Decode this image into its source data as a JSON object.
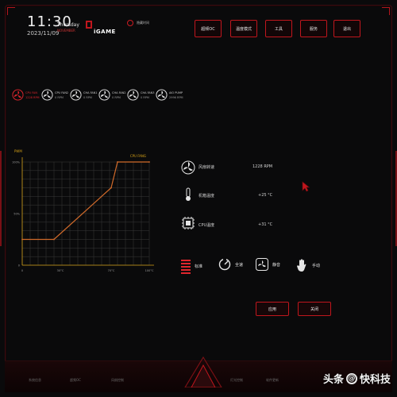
{
  "header": {
    "time": "11:30",
    "date": "2023/11/09",
    "weekday": "Thursday",
    "weekday_sub": "NOVEMBER",
    "logo_text": "iGAME",
    "toggle_label": "隐藏时间"
  },
  "nav": {
    "items": [
      {
        "label": "超频OC",
        "left": 245
      },
      {
        "label": "温度模式",
        "left": 290
      },
      {
        "label": "工具",
        "left": 334
      },
      {
        "label": "服务",
        "left": 378
      },
      {
        "label": "退出",
        "left": 420
      }
    ]
  },
  "fans": [
    {
      "name": "CPU FAN",
      "rpm": "1228 RPM",
      "active": true
    },
    {
      "name": "CPU FAN2",
      "rpm": "0 RPM",
      "active": false
    },
    {
      "name": "CHA FAN1",
      "rpm": "0 RPM",
      "active": false
    },
    {
      "name": "CHA FAN2",
      "rpm": "0 RPM",
      "active": false
    },
    {
      "name": "CHA FAN3",
      "rpm": "0 RPM",
      "active": false
    },
    {
      "name": "AIO PUMP",
      "rpm": "2996 RPM",
      "active": false
    }
  ],
  "chart_data": {
    "type": "line",
    "title": "PWM",
    "series": [
      {
        "name": "CPU FANG",
        "x": [
          0,
          25,
          70,
          75,
          100
        ],
        "y": [
          25,
          25,
          75,
          100,
          100
        ]
      }
    ],
    "xlabel": "",
    "ylabel": "PWM",
    "x_ticks": [
      "0",
      "30°C",
      "70°C",
      "100°C"
    ],
    "y_ticks": [
      "0",
      "50%",
      "100%"
    ],
    "xlim": [
      0,
      100
    ],
    "ylim": [
      0,
      100
    ],
    "grid": true,
    "colors": {
      "line": "#d06a2a",
      "grid": "#3a3a3a",
      "axis": "#d4a017"
    }
  },
  "info": {
    "fan_speed_label": "风扇转速",
    "fan_speed_value": "1228 RPM",
    "case_temp_label": "机箱温度",
    "case_temp_value": "+25 °C",
    "cpu_temp_label": "CPU温度",
    "cpu_temp_value": "+31 °C"
  },
  "modes": [
    {
      "label": "标准",
      "icon": "bars-icon"
    },
    {
      "label": "全速",
      "icon": "gauge-icon"
    },
    {
      "label": "静音",
      "icon": "fan-quiet-icon"
    },
    {
      "label": "手动",
      "icon": "hand-icon"
    }
  ],
  "actions": {
    "apply": "应用",
    "close": "关闭"
  },
  "bottom": {
    "labels": [
      "系统信息",
      "超频OC",
      "风扇控制",
      "灯光控制",
      "软件更新"
    ]
  },
  "watermark": {
    "text_left": "头条",
    "text_right": "快科技"
  },
  "colors": {
    "accent": "#c0161d",
    "background": "#0a0a0b"
  }
}
